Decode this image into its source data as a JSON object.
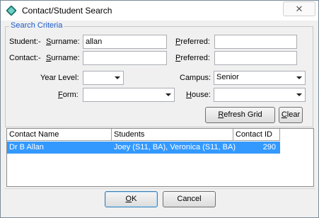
{
  "window": {
    "title": "Contact/Student Search",
    "close_glyph": "✕",
    "icon": "diamond-app-icon"
  },
  "search_criteria": {
    "group_label": "Search Criteria",
    "student_prefix": "Student:-",
    "contact_prefix": "Contact:-",
    "surname_label": "Surname:",
    "preferred_label": "Preferred:",
    "student_surname_value": "allan",
    "student_preferred_value": "",
    "contact_surname_value": "",
    "contact_preferred_value": "",
    "year_level_label": "Year Level:",
    "year_level_value": "",
    "campus_label": "Campus:",
    "campus_value": "Senior",
    "form_label": "Form:",
    "form_value": "",
    "house_label": "House:",
    "house_value": "",
    "refresh_label": "Refresh Grid",
    "clear_label": "Clear"
  },
  "grid": {
    "columns": [
      "Contact Name",
      "Students",
      "Contact ID"
    ],
    "rows": [
      {
        "contact_name": "Dr B Allan",
        "students": "Joey (S11, BA), Veronica (S11, BA)",
        "contact_id": "290",
        "selected": true
      }
    ],
    "selection_color": "#3399ff"
  },
  "footer": {
    "ok_label": "OK",
    "cancel_label": "Cancel"
  }
}
